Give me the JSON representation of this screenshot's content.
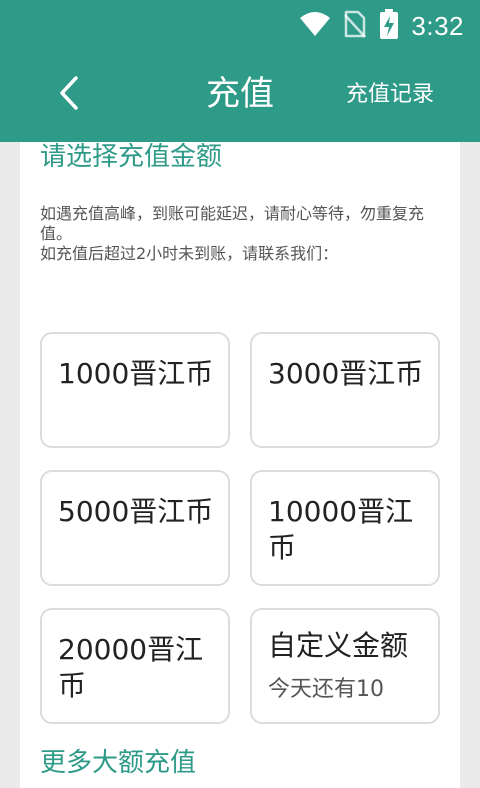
{
  "status_bar": {
    "time": "3:32"
  },
  "header": {
    "title": "充值",
    "record_link": "充值记录"
  },
  "content": {
    "section_title": "请选择充值金额",
    "notice_line1": "如遇充值高峰，到账可能延迟，请耐心等待，勿重复充值。",
    "notice_line2": "如充值后超过2小时未到账，请联系我们："
  },
  "options": [
    {
      "label": "1000晋江币"
    },
    {
      "label": "3000晋江币"
    },
    {
      "label": "5000晋江币"
    },
    {
      "label": "10000晋江币"
    },
    {
      "label": "20000晋江币"
    },
    {
      "label": "自定义金额",
      "sub": "今天还有10"
    }
  ],
  "more_link": "更多大额充值",
  "colors": {
    "accent": "#2e9a88",
    "background": "#eaeaea",
    "card": "#ffffff"
  },
  "icons": [
    "wifi-icon",
    "no-sim-icon",
    "battery-charging-icon",
    "back-arrow-icon"
  ]
}
